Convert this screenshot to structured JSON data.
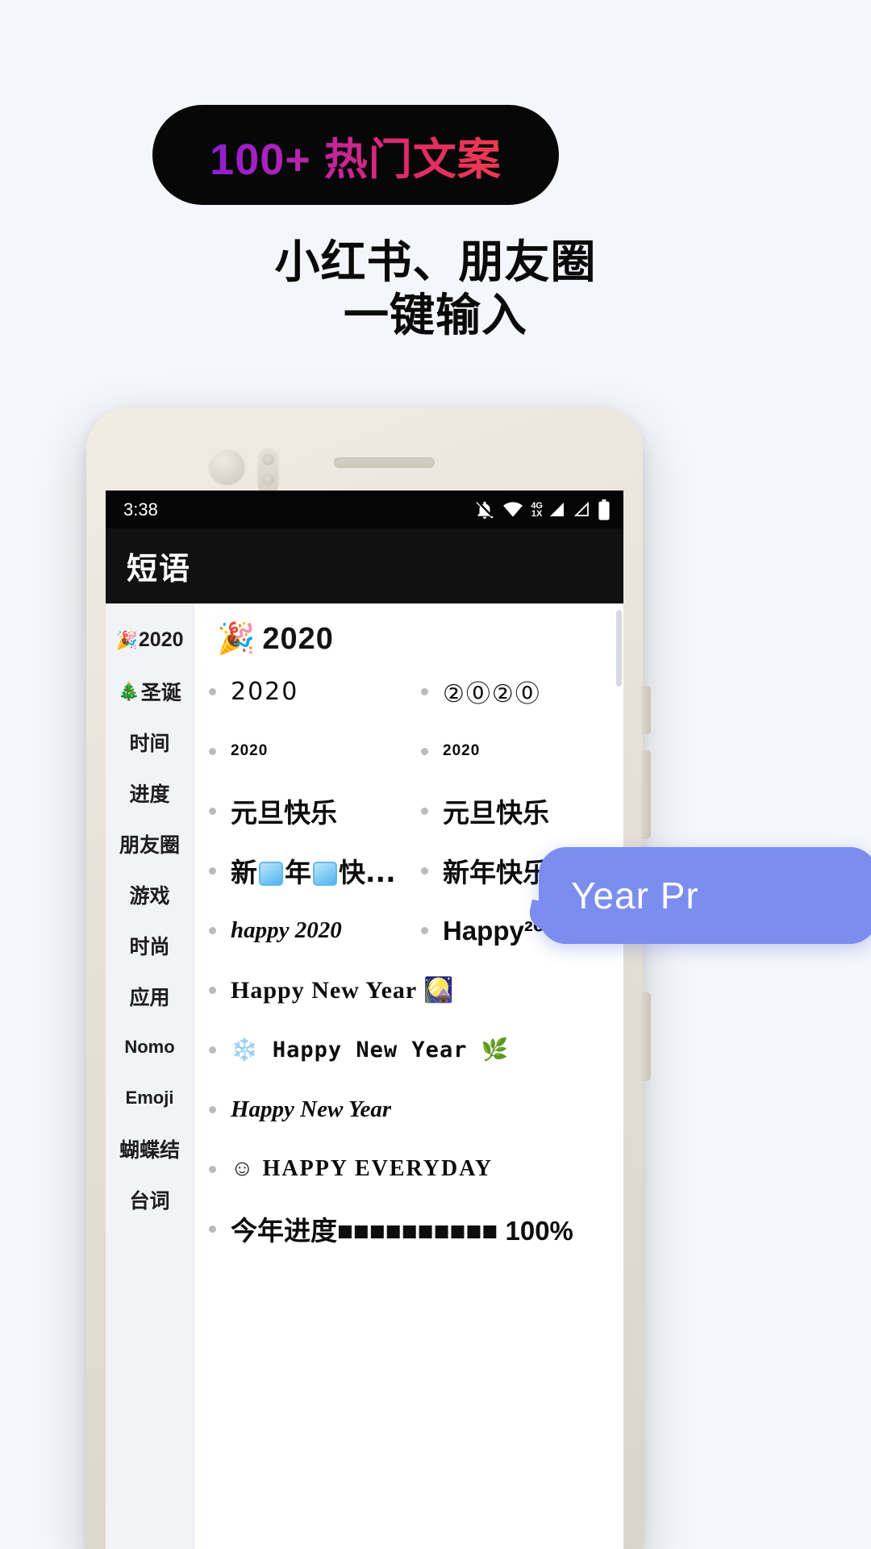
{
  "badge": {
    "text": "100+ 热门文案",
    "bg": "#070707",
    "gradient_from": "#8c1fd0",
    "gradient_to": "#ef3b4f"
  },
  "headline": {
    "line1": "小红书、朋友圈",
    "line2": "一键输入"
  },
  "phone": {
    "statusbar": {
      "time": "3:38",
      "icons": [
        "bell-off-icon",
        "wifi-icon",
        "signal-4g-icon",
        "signal-bars-icon",
        "battery-icon"
      ],
      "network_top": "4G",
      "network_bottom": "1X"
    },
    "appbar": {
      "title": "短语"
    },
    "sidebar": {
      "items": [
        {
          "emoji": "🎉",
          "label": "2020",
          "active": true
        },
        {
          "emoji": "🎄",
          "label": "圣诞"
        },
        {
          "emoji": "",
          "label": "时间"
        },
        {
          "emoji": "",
          "label": "进度"
        },
        {
          "emoji": "",
          "label": "朋友圈"
        },
        {
          "emoji": "",
          "label": "游戏"
        },
        {
          "emoji": "",
          "label": "时尚"
        },
        {
          "emoji": "",
          "label": "应用"
        },
        {
          "emoji": "",
          "label": "Nomo"
        },
        {
          "emoji": "",
          "label": "Emoji"
        },
        {
          "emoji": "",
          "label": "蝴蝶结"
        },
        {
          "emoji": "",
          "label": "台词"
        }
      ]
    },
    "list": {
      "section_emoji": "🎉",
      "section_title": "2020",
      "left_column": [
        {
          "text": "2020",
          "style": "outline"
        },
        {
          "text": "2020",
          "style": "small"
        },
        {
          "text": "元旦快乐",
          "style": "hei"
        },
        {
          "text": "新年快...",
          "style": "hei-squares"
        },
        {
          "text": "happy 2020",
          "style": "script"
        }
      ],
      "right_column": [
        {
          "text": "②⓪②⓪",
          "style": "circled"
        },
        {
          "text": "2020",
          "style": "small"
        },
        {
          "text": "元旦快乐",
          "style": "hei"
        },
        {
          "text": "新年快乐",
          "style": "hei"
        },
        {
          "text": "Happy²⁰²⁰",
          "style": "bold"
        }
      ],
      "full_rows": [
        {
          "text": "Happy New Year 🎑",
          "style": "serif"
        },
        {
          "text": "❄️ Happy New Year 🌿",
          "style": "mono"
        },
        {
          "text": "Happy New Year",
          "style": "script-italic"
        },
        {
          "text": "☺ HAPPY EVERYDAY",
          "style": "caps"
        },
        {
          "text": "今年进度■■■■■■■■■■ 100%",
          "style": "progress"
        }
      ]
    }
  },
  "bubble": {
    "text": "Year Pr",
    "color": "#7b8ef0"
  }
}
